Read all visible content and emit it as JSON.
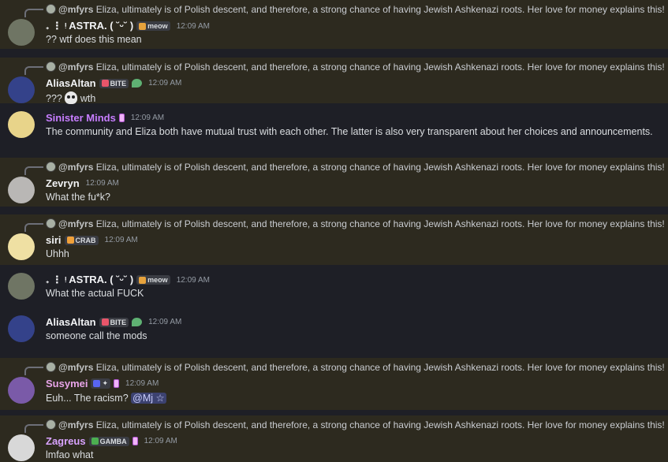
{
  "reply_text": "Eliza, ultimately is of Polish descent, and therefore, a strong chance of having Jewish Ashkenazi roots. Her love for money explains this!",
  "reply_author": "@mfyrs",
  "messages": [
    {
      "reply": true,
      "name": "𝅄 ⋮ ᵎ ASTRA. ( ˘ᵕ˘ )",
      "tag": "meow",
      "time": "12:09 AM",
      "text": "?? wtf does this mean",
      "name_color": "#f2f3f5",
      "avatar": "#6f7564"
    },
    {
      "reply": true,
      "name": "AliasAltan",
      "tag": "BITE",
      "leaf": true,
      "time": "12:09 AM",
      "text": "???",
      "text_after": "wth",
      "skull": true,
      "name_color": "#f2f3f5",
      "avatar": "#34428a"
    },
    {
      "reply": false,
      "name": "Sinister Minds",
      "badge": true,
      "time": "12:09 AM",
      "text": "The community and Eliza both have mutual trust with each other. The latter is also very transparent about her choices and announcements.",
      "name_color": "#c77dff",
      "avatar": "#e8d48a"
    },
    {
      "reply": true,
      "name": "Zevryn",
      "time": "12:09 AM",
      "text": "What the fu*k?",
      "name_color": "#f2f3f5",
      "avatar": "#b9b7b5"
    },
    {
      "reply": true,
      "name": "siri",
      "tag": "CRAB",
      "time": "12:09 AM",
      "text": "Uhhh",
      "name_color": "#f2f3f5",
      "avatar": "#efe0a3"
    },
    {
      "reply": false,
      "name": "𝅄 ⋮ ᵎ ASTRA. ( ˘ᵕ˘ )",
      "tag": "meow",
      "time": "12:09 AM",
      "text": "What the actual FUCK",
      "name_color": "#f2f3f5",
      "avatar": "#6f7564"
    },
    {
      "reply": false,
      "name": "AliasAltan",
      "tag": "BITE",
      "leaf": true,
      "time": "12:09 AM",
      "text": "someone call the mods",
      "name_color": "#f2f3f5",
      "avatar": "#34428a"
    },
    {
      "reply": true,
      "name": "Susymei",
      "tag": "✦",
      "badge": true,
      "time": "12:09 AM",
      "text": "Euh... The racism?",
      "mention": "@Mj ☆",
      "name_color": "#e8a4e8",
      "avatar": "#7a5aa8"
    },
    {
      "reply": true,
      "name": "Zagreus",
      "tag": "GAMBA",
      "badge": true,
      "time": "12:09 AM",
      "text": "lmfao what",
      "name_color": "#d9a3ff",
      "avatar": "#d8d8d8"
    }
  ]
}
